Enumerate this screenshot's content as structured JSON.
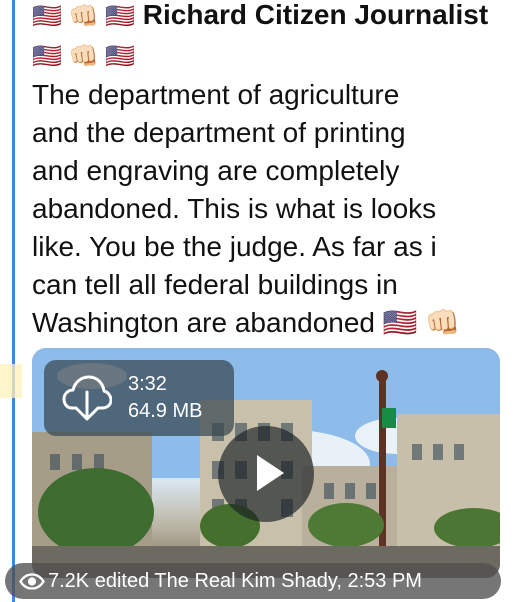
{
  "post": {
    "author": "Richard Citizen Journalist",
    "author_prefix_emoji": "🇺🇸 👊🏻 🇺🇸",
    "author_suffix_emoji": "🇺🇸 👊🏻 🇺🇸",
    "body_lines": [
      "The department of agriculture",
      "and the department of printing",
      "and engraving are completely",
      "abandoned. This is what is looks",
      "like. You be the judge. As far as i",
      "can tell all federal buildings in",
      "Washington are abandoned 🇺🇸 👊🏻"
    ]
  },
  "media": {
    "duration": "3:32",
    "file_size": "64.9 MB",
    "download_icon": "cloud-download-icon",
    "play_icon": "play-icon"
  },
  "meta": {
    "views": "7.2K",
    "status": "edited",
    "signature": "The Real Kim Shady,",
    "time": "2:53 PM",
    "views_icon": "eye-icon"
  }
}
